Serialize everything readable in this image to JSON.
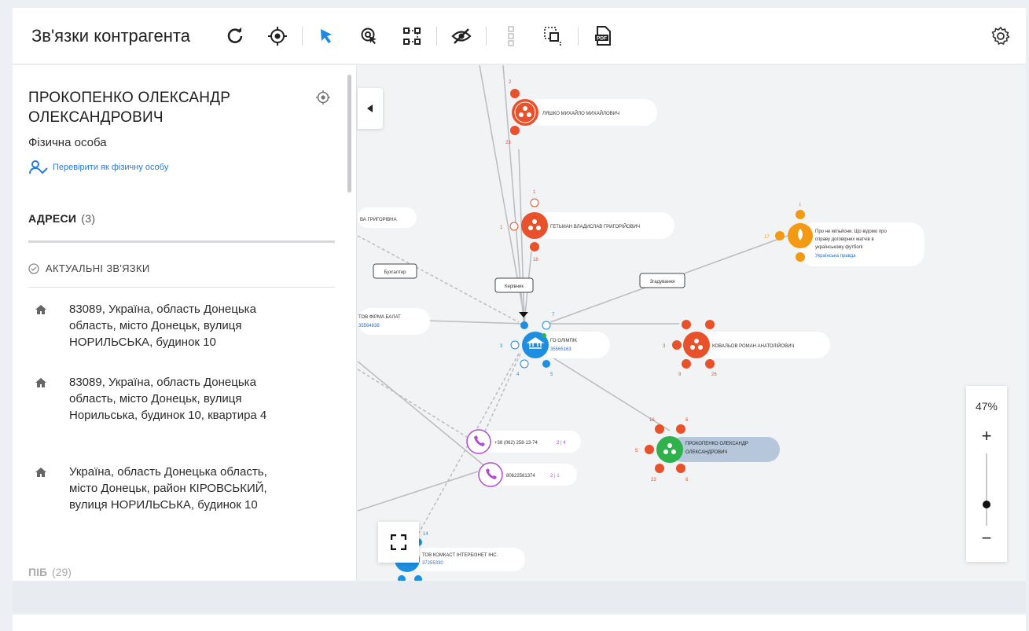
{
  "toolbar": {
    "title": "Зв'язки контрагента",
    "icons": [
      "refresh-icon",
      "locate-icon",
      "select-pointer-icon",
      "lasso-select-icon",
      "node-connect-icon",
      "hide-icon",
      "layout-icon",
      "group-select-icon",
      "pdf-export-icon",
      "settings-icon"
    ]
  },
  "panel": {
    "name": "ПРОКОПЕНКО ОЛЕКСАНДР ОЛЕКСАНДРОВИЧ",
    "type": "Фізична особа",
    "check_link": "Перевірити як фізичну особу",
    "addresses_title": "АДРЕСИ",
    "addresses_count": "(3)",
    "actual_links": "АКТУАЛЬНІ ЗВ'ЯЗКИ",
    "addresses": [
      "83089, Україна, область Донецька область, місто Донецьк, вулиця НОРИЛЬСЬКА, будинок 10",
      "83089, Україна, область Донецька область, місто Донецьк, вулиця Норильська, будинок 10, квартира 4",
      "Україна, область Донецька область, місто Донецьк, район КІРОВСЬКИЙ, вулиця НОРИЛЬСЬКА, будинок 10"
    ],
    "pib_title": "ПІБ",
    "pib_count": "(29)"
  },
  "graph": {
    "zoom_label": "47%",
    "zoom_plus": "+",
    "zoom_minus": "−",
    "zoom_level_percent": 47,
    "colors": {
      "person": "#e8512a",
      "company": "#1e8fe0",
      "phone": "#b14bd0",
      "event": "#f39a12",
      "focus": "#2fb24c",
      "edge": "#b9bcc0"
    },
    "nodes": {
      "person1": "ЛЯШКО МИХАЙЛО МИХАЙЛОВИЧ",
      "person2": "ГЕТЬМАН ВЛАДИСЛАВ ГРИГОРІЙОВИЧ",
      "person3": "КОВАЛЬОВ РОМАН АНАТОЛІЙОВИЧ",
      "focus_line1": "ПРОКОПЕНКО ОЛЕКСАНДР",
      "focus_line2": "ОЛЕКСАНДРОВИЧ",
      "company_center": "ГО ОЛІМПІК",
      "company_center_code": "35565163",
      "company_left": "ТОВ ФІРМА БАЛАТ",
      "company_left_code": "35564838",
      "company_bottom": "ТОВ КОМКАСТ ІНТЕРБІЗНЕТ ІНС.",
      "company_bottom_code": "37255330",
      "partial_person": "ВА ГРИГОРІВНА",
      "phone1": "+38 (062) 258-13-74",
      "phone1_meta": "2 | 4",
      "phone2": "80622581374",
      "phone2_meta": "2 | 1",
      "event_line1": "Про не мільйони. Що відомо про",
      "event_line2": "справу договірних матчів в",
      "event_line3": "українському футболі",
      "event_source": "Українська правда"
    },
    "edge_labels": {
      "accountant": "Бухгалтер",
      "manager": "Керівник",
      "mention": "Згадування"
    },
    "badge_counts": {
      "p1_top": "2",
      "p1_bottom": "23",
      "p2_top": "1",
      "p2_left": "1",
      "p2_bottom": "18",
      "p3_left": "3",
      "p3_bottom_left": "9",
      "p3_bottom_right": "26",
      "focus_top": "16",
      "focus_top_right": "6",
      "focus_left": "5",
      "focus_bottom": "23",
      "focus_bottom_right": "6",
      "ev_top": "1",
      "ev_left": "17",
      "c_left": "3",
      "c_right": "7",
      "c_bottom": "4",
      "c_bottom2": "5",
      "cb_top": "14"
    }
  }
}
